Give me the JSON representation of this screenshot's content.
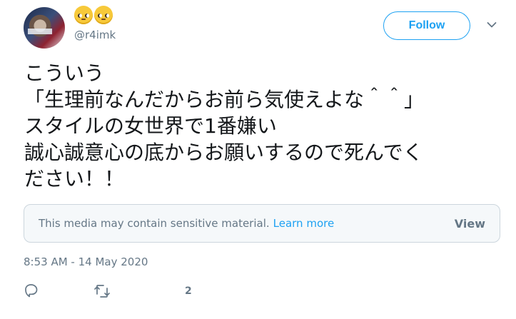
{
  "user": {
    "handle": "@r4imk",
    "display_name_icons": [
      "face-with-rolling-eyes-emoji",
      "face-with-rolling-eyes-emoji"
    ]
  },
  "follow_button": {
    "label": "Follow"
  },
  "tweet": {
    "lines": [
      "こういう",
      "「生理前なんだからお前ら気使えよな＾＾」",
      "スタイルの女世界で1番嫌い",
      "誠心誠意心の底からお願いするので死んでく",
      "ださい！！"
    ]
  },
  "sensitive_notice": {
    "text": "This media may contain sensitive material.",
    "link": "Learn more",
    "view": "View"
  },
  "timestamp": "8:53 AM - 14 May 2020",
  "actions": {
    "icons": [
      "reply-icon",
      "retweet-icon"
    ],
    "like_count": "2"
  },
  "colors": {
    "accent": "#1da1f2",
    "secondary_text": "#657786",
    "primary_text": "#14171a",
    "border": "#ccd6dd",
    "notice_bg": "#f5f8fa"
  }
}
